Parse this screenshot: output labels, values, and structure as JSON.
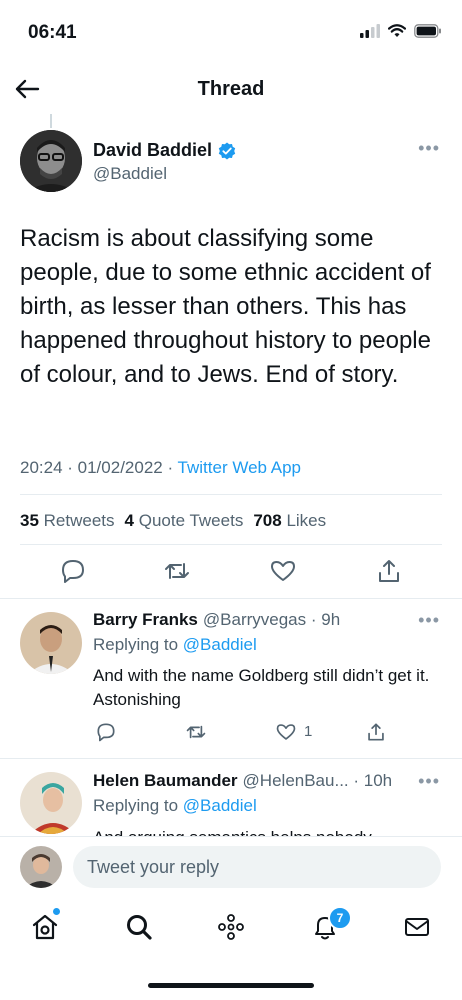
{
  "status_bar": {
    "time": "06:41"
  },
  "header": {
    "title": "Thread"
  },
  "main_tweet": {
    "name": "David Baddiel",
    "handle": "@Baddiel",
    "text": "Racism is about classifying some people, due to some ethnic accident of birth, as lesser than others. This has happened throughout history to people of colour, and to Jews. End of story.",
    "time": "20:24 · 01/02/2022 · ",
    "source": "Twitter Web App",
    "retweets_count": "35",
    "retweets_label": "Retweets",
    "quotes_count": "4",
    "quotes_label": "Quote Tweets",
    "likes_count": "708",
    "likes_label": "Likes"
  },
  "replies": [
    {
      "name": "Barry Franks",
      "handle_time": "@Barryvegas · 9h",
      "replying_prefix": "Replying to",
      "replying_handle": "@Baddiel",
      "text": "And with the name Goldberg still didn’t get it. Astonishing",
      "like_count": "1"
    },
    {
      "name": "Helen Baumander",
      "handle_time": "@HelenBau... · 10h",
      "replying_prefix": "Replying to",
      "replying_handle": "@Baddiel",
      "text": "And arguing semantics helps nobody"
    }
  ],
  "compose": {
    "placeholder": "Tweet your reply"
  },
  "tab_bar": {
    "notifications_badge": "7"
  },
  "colors": {
    "accent": "#1d9bf0",
    "text": "#0f1419",
    "muted": "#536471"
  }
}
